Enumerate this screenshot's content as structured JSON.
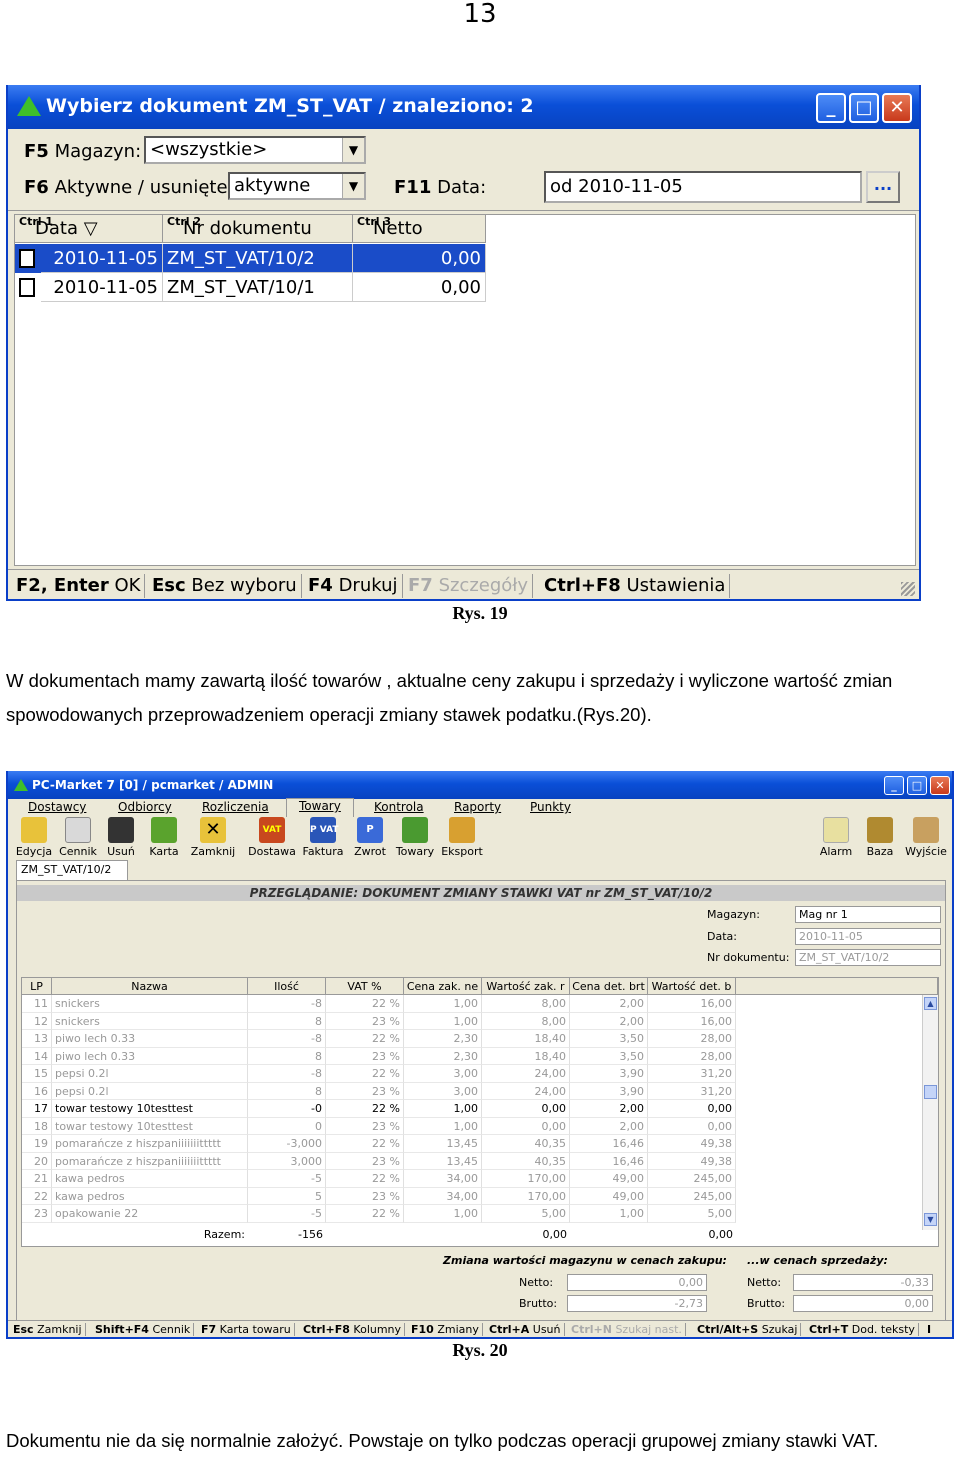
{
  "page_number": "13",
  "window1": {
    "title": "Wybierz dokument ZM_ST_VAT / znaleziono: 2",
    "magazyn_key": "F5",
    "magazyn_label": "Magazyn:",
    "magazyn_value": "<wszystkie>",
    "aktywne_key": "F6",
    "aktywne_label": "Aktywne / usunięte:",
    "aktywne_value": "aktywne",
    "data_key": "F11",
    "data_label": "Data:",
    "data_value": "od 2010-11-05",
    "dots_button": "...",
    "columns": [
      {
        "ctrl": "Ctrl 1",
        "label": "Data"
      },
      {
        "ctrl": "Ctrl 2",
        "label": "Nr dokumentu"
      },
      {
        "ctrl": "Ctrl 3",
        "label": "Netto"
      }
    ],
    "rows": [
      {
        "date": "2010-11-05",
        "nr": "ZM_ST_VAT/10/2",
        "netto": "0,00"
      },
      {
        "date": "2010-11-05",
        "nr": "ZM_ST_VAT/10/1",
        "netto": "0,00"
      }
    ],
    "statusbar": [
      {
        "key": "F2, Enter",
        "label": "OK"
      },
      {
        "key": "Esc",
        "label": "Bez wyboru"
      },
      {
        "key": "F4",
        "label": "Drukuj"
      },
      {
        "key": "F7",
        "label": "Szczegóły"
      },
      {
        "key": "Ctrl+F8",
        "label": "Ustawienia"
      }
    ]
  },
  "caption1": "Rys. 19",
  "paragraph1_line1": "W dokumentach mamy zawartą ilość towarów , aktualne ceny zakupu  i sprzedaży i wyliczone wartość zmian",
  "paragraph1_line2": "spowodowanych przeprowadzeniem operacji zmiany stawek podatku.(Rys.20).",
  "window2": {
    "title": "PC-Market 7 [0] / pcmarket / ADMIN",
    "menu": [
      "Dostawcy",
      "Odbiorcy",
      "Rozliczenia",
      "Towary",
      "Kontrola",
      "Raporty",
      "Punkty"
    ],
    "toolbar": [
      "Edycja",
      "Cennik",
      "Usuń",
      "Karta",
      "Zamknij",
      "Dostawa",
      "Faktura",
      "Zwrot",
      "Towary",
      "Eksport"
    ],
    "toolbar_right": [
      "Alarm",
      "Baza",
      "Wyjście"
    ],
    "doc_tab": "ZM_ST_VAT/10/2",
    "panel_title": "PRZEGLĄDANIE: DOKUMENT ZMIANY STAWKI VAT nr ZM_ST_VAT/10/2",
    "magazyn_label": "Magazyn:",
    "magazyn_value": "Mag nr 1",
    "data_label": "Data:",
    "data_value": "2010-11-05",
    "nr_label": "Nr dokumentu:",
    "nr_value": "ZM_ST_VAT/10/2",
    "columns": [
      "LP",
      "Nazwa",
      "Ilość",
      "VAT %",
      "Cena zak. ne",
      "Wartość zak. r",
      "Cena det. brt",
      "Wartość det. b"
    ],
    "rows": [
      [
        "11",
        "snickers",
        "-8",
        "22 %",
        "1,00",
        "8,00",
        "2,00",
        "16,00"
      ],
      [
        "12",
        "snickers",
        "8",
        "23 %",
        "1,00",
        "8,00",
        "2,00",
        "16,00"
      ],
      [
        "13",
        "piwo lech 0.33",
        "-8",
        "22 %",
        "2,30",
        "18,40",
        "3,50",
        "28,00"
      ],
      [
        "14",
        "piwo lech 0.33",
        "8",
        "23 %",
        "2,30",
        "18,40",
        "3,50",
        "28,00"
      ],
      [
        "15",
        "pepsi 0.2l",
        "-8",
        "22 %",
        "3,00",
        "24,00",
        "3,90",
        "31,20"
      ],
      [
        "16",
        "pepsi 0.2l",
        "8",
        "23 %",
        "3,00",
        "24,00",
        "3,90",
        "31,20"
      ],
      [
        "17",
        "towar testowy 10testtest",
        "-0",
        "22 %",
        "1,00",
        "0,00",
        "2,00",
        "0,00"
      ],
      [
        "18",
        "towar testowy 10testtest",
        "0",
        "23 %",
        "1,00",
        "0,00",
        "2,00",
        "0,00"
      ],
      [
        "19",
        "pomarańcze z hiszpaniiiiiiittttt",
        "-3,000",
        "22 %",
        "13,45",
        "40,35",
        "16,46",
        "49,38"
      ],
      [
        "20",
        "pomarańcze z hiszpaniiiiiiittttt",
        "3,000",
        "23 %",
        "13,45",
        "40,35",
        "16,46",
        "49,38"
      ],
      [
        "21",
        "kawa pedros",
        "-5",
        "22 %",
        "34,00",
        "170,00",
        "49,00",
        "245,00"
      ],
      [
        "22",
        "kawa pedros",
        "5",
        "23 %",
        "34,00",
        "170,00",
        "49,00",
        "245,00"
      ],
      [
        "23",
        "opakowanie 22",
        "-5",
        "22 %",
        "1,00",
        "5,00",
        "1,00",
        "5,00"
      ]
    ],
    "razem_label": "Razem:",
    "razem_ilosc": "-156",
    "razem_wart_zak": "0,00",
    "razem_wart_det": "0,00",
    "zmiana_zakup_label": "Zmiana wartości magazynu w cenach zakupu:",
    "zmiana_sprz_label": "...w cenach sprzedaży:",
    "netto_label": "Netto:",
    "brutto_label": "Brutto:",
    "zakup_netto": "0,00",
    "zakup_brutto": "-2,73",
    "sprz_netto": "-0,33",
    "sprz_brutto": "0,00",
    "statusbar": [
      {
        "key": "Esc",
        "label": "Zamknij"
      },
      {
        "key": "Shift+F4",
        "label": "Cennik"
      },
      {
        "key": "F7",
        "label": "Karta towaru"
      },
      {
        "key": "Ctrl+F8",
        "label": "Kolumny"
      },
      {
        "key": "F10",
        "label": "Zmiany"
      },
      {
        "key": "Ctrl+A",
        "label": "Usuń"
      },
      {
        "key": "Ctrl+N",
        "label": "Szukaj nast."
      },
      {
        "key": "Ctrl/Alt+S",
        "label": "Szukaj"
      },
      {
        "key": "Ctrl+T",
        "label": "Dod. teksty"
      },
      {
        "key": "I",
        "label": ""
      }
    ]
  },
  "caption2": "Rys. 20",
  "paragraph2": "Dokumentu nie da się normalnie założyć. Powstaje on tylko podczas operacji grupowej zmiany stawki VAT."
}
